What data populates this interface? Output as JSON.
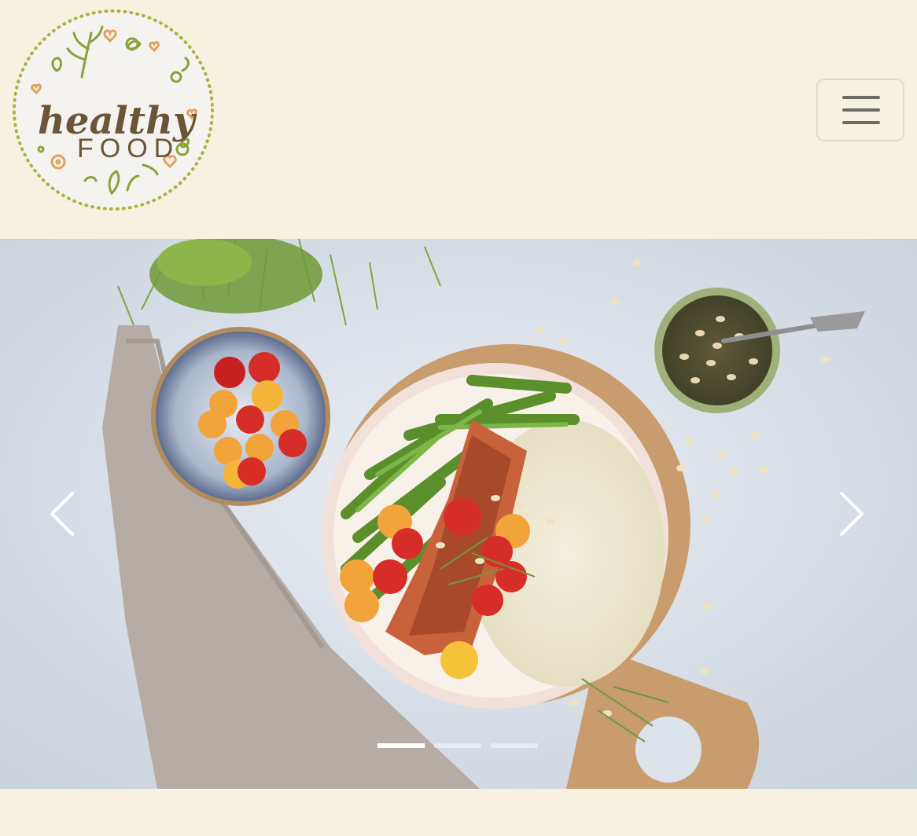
{
  "brand": {
    "logo_line1": "healthy",
    "logo_line2": "FOOD",
    "logo_icon": "healthy-food-badge",
    "colors": {
      "brown": "#6a5637",
      "green": "#8aa23c",
      "orange": "#e3a15a",
      "dots": "#a7b43f"
    }
  },
  "nav": {
    "toggle_icon": "hamburger-menu-icon"
  },
  "carousel": {
    "prev_icon": "chevron-left-icon",
    "next_icon": "chevron-right-icon",
    "slide_count": 3,
    "active_index": 0,
    "slide_image": "salmon-bowl-photo"
  },
  "colors": {
    "page_background": "#f6f1e0",
    "slide_background": "#dde3eb",
    "indicator_active": "#ffffff"
  }
}
